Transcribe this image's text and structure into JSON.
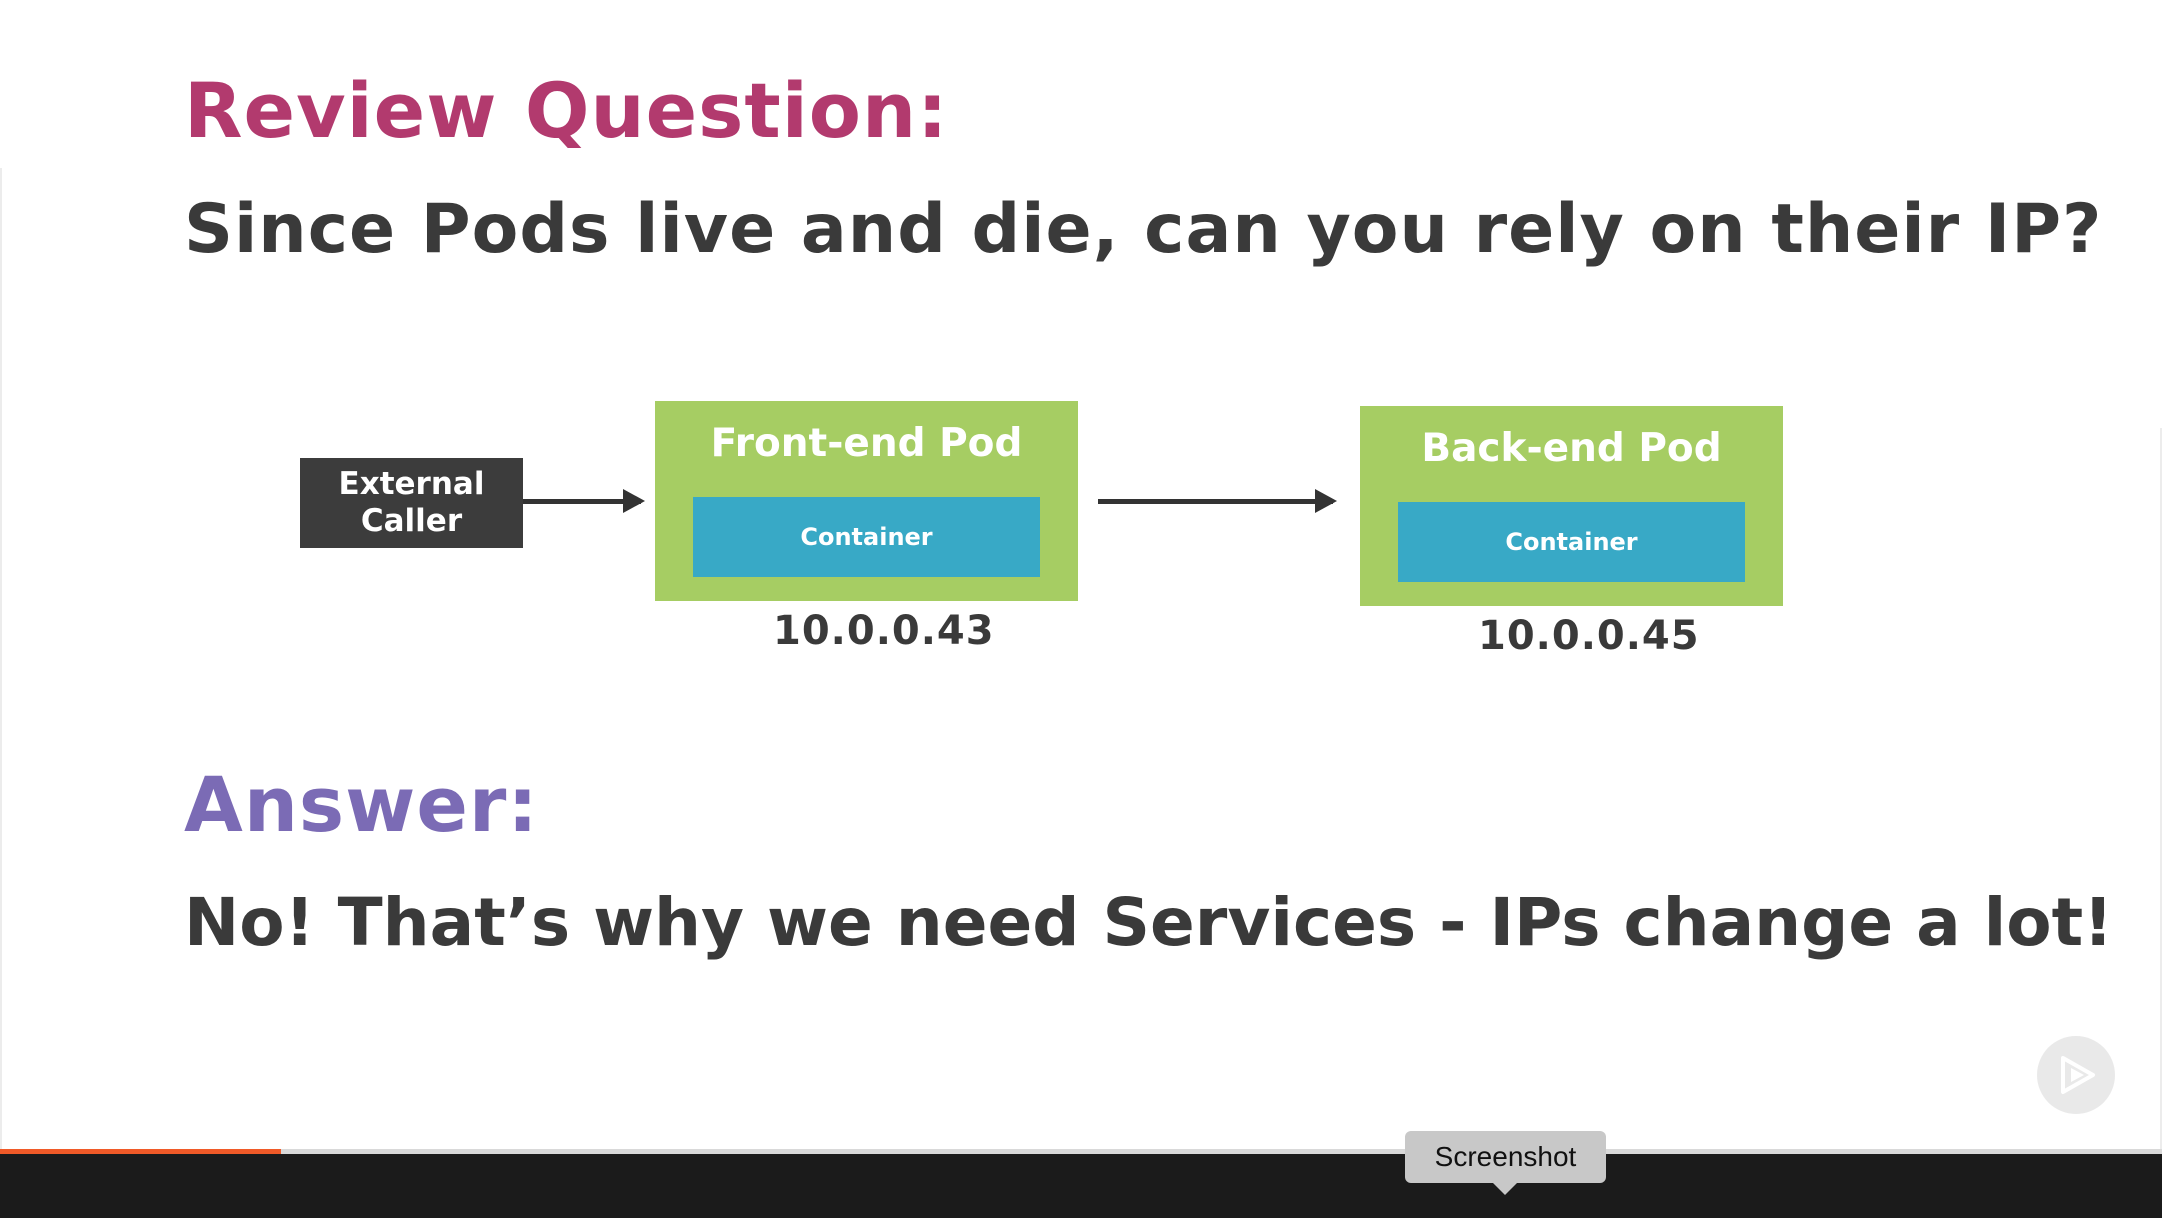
{
  "slide": {
    "heading": "Review Question:",
    "question": "Since Pods live and die, can you rely on their IP?",
    "diagram": {
      "caller_label": "External Caller",
      "frontend": {
        "title": "Front-end Pod",
        "container_label": "Container",
        "ip": "10.0.0.43"
      },
      "backend": {
        "title": "Back-end Pod",
        "container_label": "Container",
        "ip": "10.0.0.45"
      }
    },
    "answer_heading": "Answer:",
    "answer": "No! That’s why we need Services - IPs change a lot!"
  },
  "player": {
    "progress_fraction": 0.13,
    "tooltip": "Screenshot",
    "logo_icon": "pluralsight-play-icon"
  },
  "colors": {
    "question_heading": "#b23a6e",
    "answer_heading": "#7b6bb5",
    "pod": "#a6cd63",
    "container": "#38a9c6",
    "caller": "#3c3c3c",
    "progress": "#f05a28",
    "control_bar": "#1b1b1b"
  }
}
